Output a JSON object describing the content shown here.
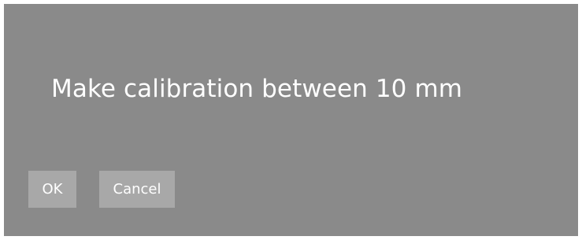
{
  "dialog": {
    "message": "Make calibration between 10 mm",
    "ok_label": "OK",
    "cancel_label": "Cancel"
  },
  "colors": {
    "dialog_background": "#8a8a8a",
    "button_background": "#a8a8a8",
    "text": "#ffffff"
  }
}
